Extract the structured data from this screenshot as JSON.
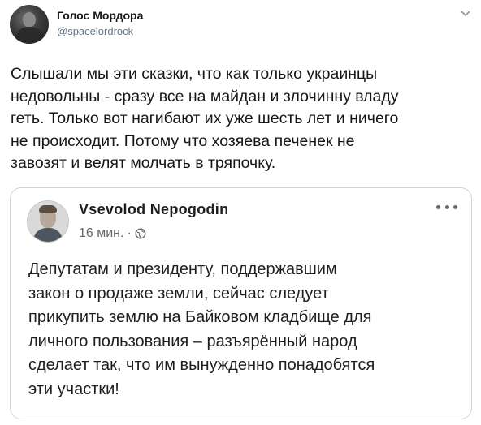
{
  "tweet": {
    "author_name": "Голос Мордора",
    "author_handle": "@spacelordrock",
    "caret_icon": "chevron-down-icon",
    "text": "Слышали мы эти сказки, что как только украинцы\nнедовольны - сразу все на майдан и злочинну владу\nгеть. Только вот нагибают их уже шесть лет и ничего\nне происходит. Потому что хозяева печенек не\nзавозят и велят молчать в тряпочку."
  },
  "embedded_post": {
    "author_name": "Vsevolod Nepogodin",
    "time": "16 мин.",
    "separator": "·",
    "privacy_icon": "globe-icon",
    "more_icon": "more-options-icon",
    "text": "Депутатам и президенту, поддержавшим\nзакон о продаже земли, сейчас следует\nприкупить землю на Байковом кладбище для\nличного пользования – разъярённый народ\nсделает так, что им вынужденно понадобятся\nэти участки!"
  },
  "colors": {
    "secondary_text": "#657786",
    "border": "#ccd6dd",
    "fb_secondary": "#65676b"
  }
}
